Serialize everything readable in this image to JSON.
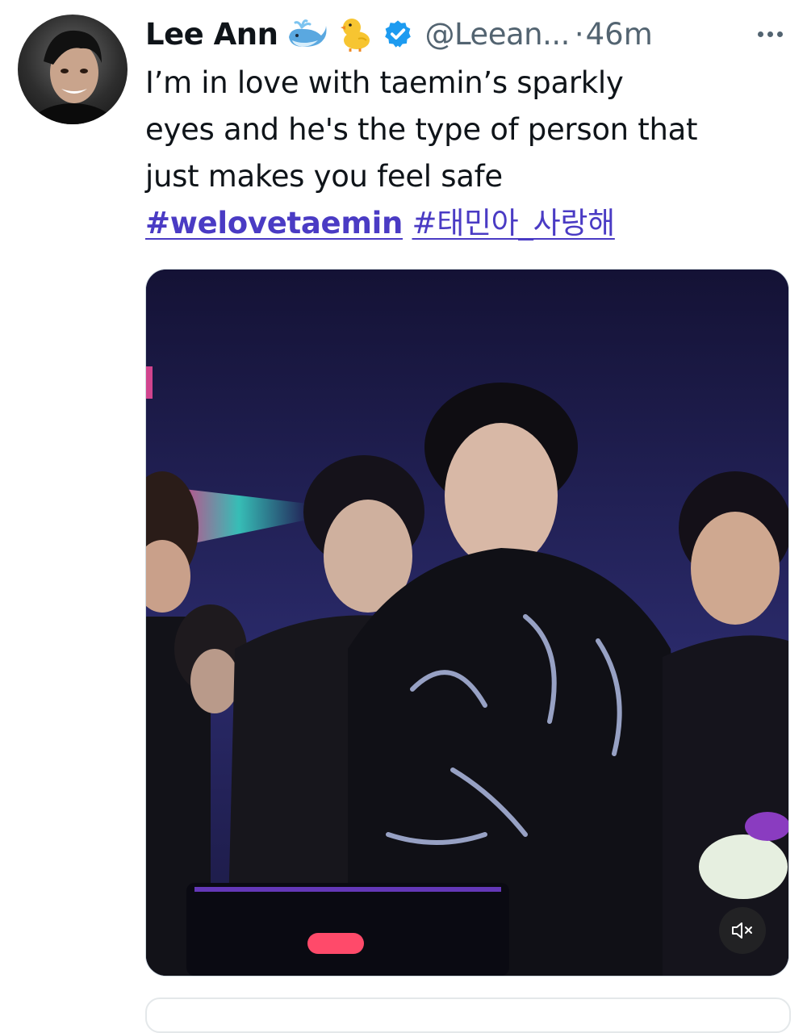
{
  "tweet": {
    "author": {
      "display_name": "Lee Ann",
      "emojis": [
        "whale-emoji",
        "chick-emoji"
      ],
      "verified": true,
      "handle": "@Leean...",
      "separator": "·",
      "time": "46m"
    },
    "text_lines": [
      "I’m in love with taemin’s sparkly",
      "eyes and he's the type of person that",
      "just makes you feel safe"
    ],
    "hashtags": [
      "#welovetaemin",
      "#태민아_사랑해"
    ],
    "media": {
      "type": "video",
      "mute_icon": "speaker-muted-icon"
    },
    "more_icon": "more-options-icon"
  },
  "colors": {
    "text": "#0f1419",
    "secondary": "#536471",
    "hashtag": "#4a3bc4",
    "verified": "#1d9bf0"
  }
}
